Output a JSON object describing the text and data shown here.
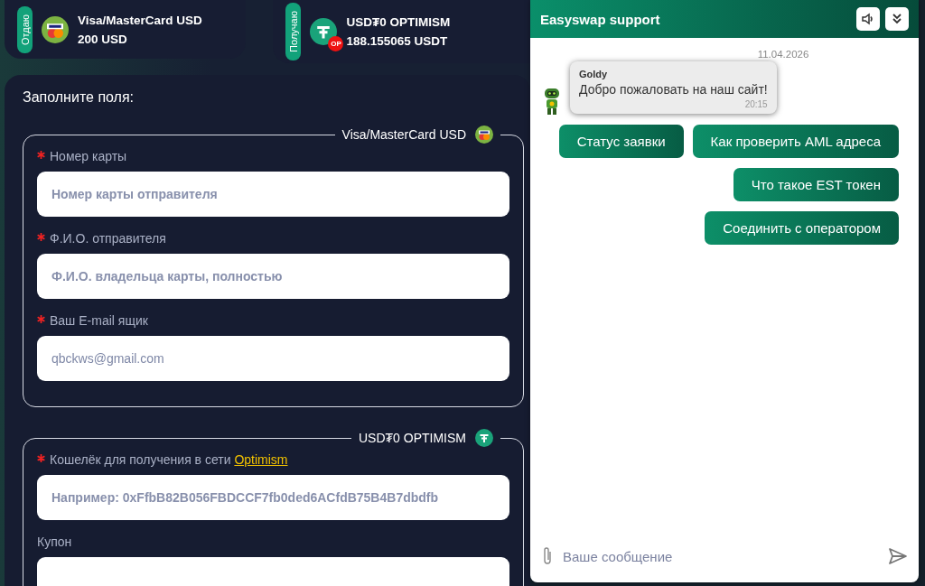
{
  "exchange": [
    {
      "tag": "Отдаю",
      "kind": "card",
      "name": "Visa/MasterCard USD",
      "amount": "200 USD"
    },
    {
      "tag": "Получаю",
      "kind": "token",
      "badge": "OP",
      "name": "USD₮0 OPTIMISM",
      "amount": "188.155065 USDT"
    }
  ],
  "form": {
    "title": "Заполните поля:",
    "sections": [
      {
        "legend": "Visa/MasterCard USD",
        "kind": "card",
        "fields": [
          {
            "label": "Номер карты",
            "required": true,
            "placeholder": "Номер карты отправителя"
          },
          {
            "label": "Ф.И.О. отправителя",
            "required": true,
            "placeholder": "Ф.И.О. владельца карты, полностью"
          },
          {
            "label": "Ваш E-mail ящик",
            "required": true,
            "value": "qbckws@gmail.com"
          }
        ]
      },
      {
        "legend": "USD₮0 OPTIMISM",
        "kind": "token",
        "fields": [
          {
            "label": "Кошелёк для получения в сети",
            "link": "Optimism",
            "required": true,
            "placeholder": "Например: 0xFfbB82B056FBDCCF7fb0ded6ACfdB75B4B7dbdfb"
          },
          {
            "label": "Купон",
            "required": false
          }
        ]
      }
    ]
  },
  "chat": {
    "title": "Easyswap support",
    "date": "11.04.2026",
    "message": {
      "author": "Goldy",
      "text": "Добро пожаловать на наш сайт!",
      "time": "20:15"
    },
    "quick_replies": [
      "Статус заявки",
      "Как проверить AML адреса",
      "Что такое EST токен",
      "Соединить с оператором"
    ],
    "input": {
      "placeholder": "Ваше сообщение"
    }
  }
}
